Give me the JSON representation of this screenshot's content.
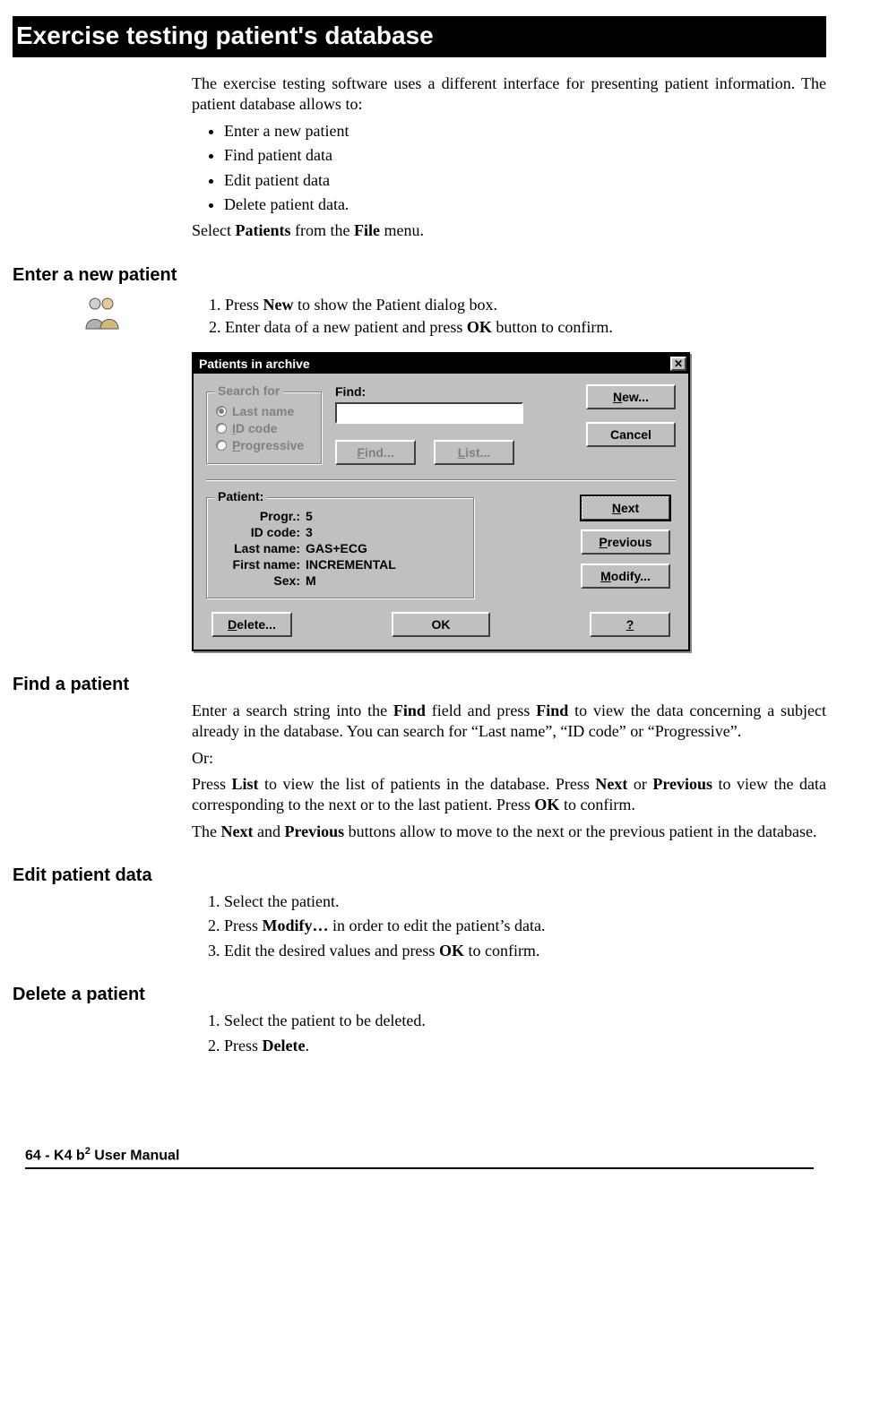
{
  "page_title": "Exercise testing patient's database",
  "intro": "The exercise testing software uses a different interface for presenting patient information. The patient database allows to:",
  "intro_bullets": [
    "Enter a new patient",
    "Find patient data",
    "Edit patient data",
    "Delete patient data."
  ],
  "intro_tail_pre": "Select ",
  "intro_tail_b1": "Patients",
  "intro_tail_mid": " from the ",
  "intro_tail_b2": "File",
  "intro_tail_post": " menu.",
  "sections": {
    "enter": {
      "heading": "Enter a new patient",
      "step1_pre": "Press ",
      "step1_b": "New",
      "step1_post": " to show the Patient dialog box.",
      "step2_pre": "Enter data of a new patient and press ",
      "step2_b": "OK",
      "step2_post": " button to confirm."
    },
    "find": {
      "heading": "Find a patient",
      "p1_a": "Enter a search string into the ",
      "p1_b1": "Find",
      "p1_b": " field and press ",
      "p1_b2": "Find",
      "p1_c": " to view the data concerning a subject already in the database. You can search for “Last name”, “ID code” or “Progressive”.",
      "or": "Or:",
      "p2_a": "Press ",
      "p2_b1": "List",
      "p2_b": " to view the list of patients in the database. Press ",
      "p2_b2": "Next",
      "p2_c": " or ",
      "p2_b3": "Previous",
      "p2_d": " to view the data corresponding to the next or to the last patient. Press ",
      "p2_b4": "OK",
      "p2_e": " to confirm.",
      "p3_a": "The ",
      "p3_b1": "Next",
      "p3_b": " and ",
      "p3_b2": "Previous",
      "p3_c": " buttons allow to move to the next or the previous patient in the database."
    },
    "edit": {
      "heading": "Edit patient data",
      "s1": "Select the patient.",
      "s2_pre": "Press ",
      "s2_b": "Modify…",
      "s2_post": " in order to edit the patient’s data.",
      "s3_pre": "Edit the desired values and press ",
      "s3_b": "OK",
      "s3_post": " to confirm."
    },
    "del": {
      "heading": "Delete a patient",
      "s1": "Select the patient to be deleted.",
      "s2_pre": "Press ",
      "s2_b": "Delete",
      "s2_post": "."
    }
  },
  "dialog": {
    "title": "Patients in archive",
    "close_glyph": "✕",
    "search_legend": "Search for",
    "radio_last": "Last name",
    "radio_id_pre": "I",
    "radio_id_post": "D code",
    "radio_prog_pre": "P",
    "radio_prog_post": "rogressive",
    "find_label": "Find:",
    "btn_find_u": "F",
    "btn_find_rest": "ind...",
    "btn_list_u": "L",
    "btn_list_rest": "ist...",
    "btn_new_u": "N",
    "btn_new_rest": "ew...",
    "btn_cancel": "Cancel",
    "patient_legend": "Patient:",
    "progr_k": "Progr.:",
    "progr_v": "5",
    "id_k": "ID code:",
    "id_v": "3",
    "last_k": "Last name:",
    "last_v": "GAS+ECG",
    "first_k": "First name:",
    "first_v": "INCREMENTAL",
    "sex_k": "Sex:",
    "sex_v": "M",
    "btn_next": "Next",
    "btn_prev_u": "P",
    "btn_prev_rest": "revious",
    "btn_mod_u": "M",
    "btn_mod_rest": "odify...",
    "btn_del_u": "D",
    "btn_del_rest": "elete...",
    "btn_ok": "OK",
    "btn_help": "?"
  },
  "footer": {
    "page": "64",
    "sep": " - ",
    "product_a": "K4 b",
    "product_sup": "2",
    "product_b": " User Manual"
  }
}
